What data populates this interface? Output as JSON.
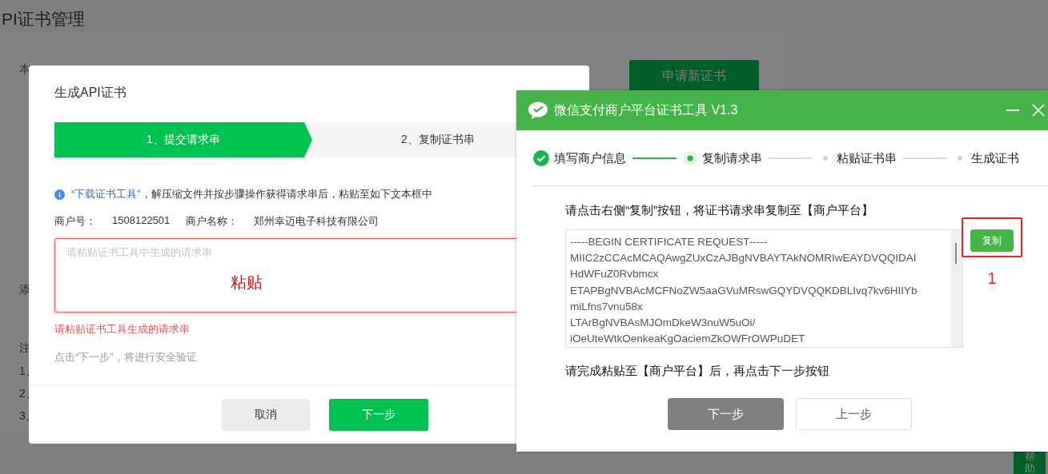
{
  "page": {
    "title": "PI证书管理",
    "apply_button": "申请新证书",
    "background_labels": [
      "本",
      "添",
      "注",
      "1、",
      "2、",
      "3、"
    ],
    "help_button": "帮助"
  },
  "dialog": {
    "title": "生成API证书",
    "steps": [
      {
        "label": "1、提交请求串",
        "selected": true
      },
      {
        "label": "2、复制证书串",
        "selected": false
      }
    ],
    "info": {
      "link": "“下载证书工具”",
      "text": "，解压缩文件并按步骤操作获得请求串后，粘贴至如下文本框中"
    },
    "merchant_id_label": "商户号：",
    "merchant_id": "1508122501",
    "merchant_name_label": "商户名称：",
    "merchant_name": "郑州幸迈电子科技有限公司",
    "request_field": {
      "placeholder": "请粘贴证书工具中生成的请求串",
      "invalid": true
    },
    "annotation": "粘贴",
    "error": "请粘贴证书工具生成的请求串",
    "hint": "点击“下一步”，将进行安全验证",
    "buttons": [
      {
        "label": "取消",
        "kind": "secondary"
      },
      {
        "label": "下一步",
        "kind": "primary"
      }
    ]
  },
  "tool_window": {
    "title": "微信支付商户平台证书工具 V1.3",
    "steps": [
      {
        "label": "填写商户信息",
        "completed": true,
        "selected": false
      },
      {
        "label": "复制请求串",
        "completed": false,
        "selected": true
      },
      {
        "label": "粘贴证书串",
        "completed": false,
        "selected": false
      },
      {
        "label": "生成证书",
        "completed": false,
        "selected": false
      }
    ],
    "instruction": "请点击右侧“复制”按钮，将证书请求串复制至【商户平台】",
    "request_lines": [
      "-----BEGIN CERTIFICATE REQUEST-----",
      "MIIC2zCCAcMCAQAwgZUxCzAJBgNVBAYTAkNOMRIwEAYDVQQIDAI",
      "HdWFuZ0Rvbmcx",
      "ETAPBgNVBAcMCFNoZW5aaGVuMRswGQYDVQQKDBLIvq7kv6HIIYb",
      "miLfns7vnu58x",
      "LTArBgNVBAsMJOmDkeW3nuW5uOi/",
      "iOeUteWtkOenkeaKgOaciemZkOWFrOWPuDET"
    ],
    "copy_button": "复制",
    "annotation": "1",
    "note": "请完成粘贴至【商户平台】后，再点击下一步按钮",
    "buttons": [
      {
        "label": "下一步",
        "kind": "disabled"
      },
      {
        "label": "上一步",
        "kind": "outline"
      }
    ]
  }
}
